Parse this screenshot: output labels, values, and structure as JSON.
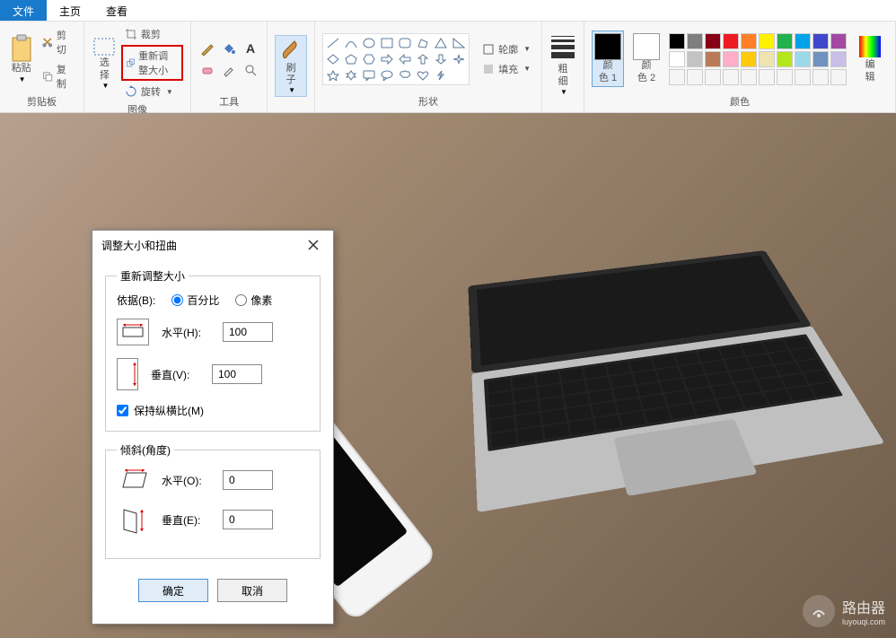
{
  "tabs": {
    "file": "文件",
    "home": "主页",
    "view": "查看"
  },
  "ribbon": {
    "clipboard": {
      "label": "剪贴板",
      "paste": "粘贴",
      "cut": "剪切",
      "copy": "复制"
    },
    "image": {
      "label": "图像",
      "select": "选\n择",
      "crop": "裁剪",
      "resize": "重新调整大小",
      "rotate": "旋转"
    },
    "tools": {
      "label": "工具"
    },
    "brush": {
      "label": "刷\n子"
    },
    "shapes": {
      "label": "形状",
      "outline": "轮廓",
      "fill": "填充"
    },
    "size": {
      "label": "粗\n细"
    },
    "colors": {
      "label": "颜色",
      "color1": "颜\n色 1",
      "color2": "颜\n色 2",
      "edit": "编\n辑",
      "color1_hex": "#000000",
      "color2_hex": "#ffffff",
      "palette": [
        "#000000",
        "#7f7f7f",
        "#880015",
        "#ed1c24",
        "#ff7f27",
        "#fff200",
        "#22b14c",
        "#00a2e8",
        "#3f48cc",
        "#a349a4",
        "#ffffff",
        "#c3c3c3",
        "#b97a57",
        "#ffaec9",
        "#ffc90e",
        "#efe4b0",
        "#b5e61d",
        "#99d9ea",
        "#7092be",
        "#c8bfe7",
        "#f5f5f5",
        "#f5f5f5",
        "#f5f5f5",
        "#f5f5f5",
        "#f5f5f5",
        "#f5f5f5",
        "#f5f5f5",
        "#f5f5f5",
        "#f5f5f5",
        "#f5f5f5"
      ]
    }
  },
  "dialog": {
    "title": "调整大小和扭曲",
    "resize": {
      "legend": "重新调整大小",
      "by_label": "依据(B):",
      "percent": "百分比",
      "pixels": "像素",
      "horizontal_label": "水平(H):",
      "horizontal_value": "100",
      "vertical_label": "垂直(V):",
      "vertical_value": "100",
      "aspect": "保持纵横比(M)"
    },
    "skew": {
      "legend": "倾斜(角度)",
      "horizontal_label": "水平(O):",
      "horizontal_value": "0",
      "vertical_label": "垂直(E):",
      "vertical_value": "0"
    },
    "ok": "确定",
    "cancel": "取消"
  },
  "watermark": {
    "text": "路由器",
    "sub": "luyouqi.com"
  }
}
